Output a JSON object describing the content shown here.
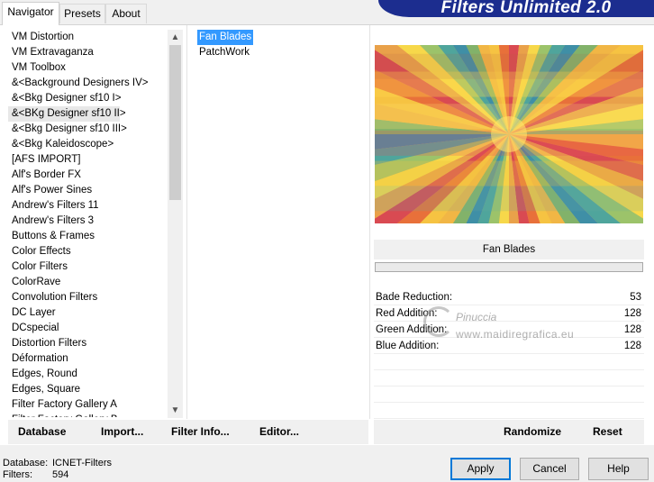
{
  "tabs": [
    {
      "label": "Navigator",
      "active": true
    },
    {
      "label": "Presets",
      "active": false
    },
    {
      "label": "About",
      "active": false
    }
  ],
  "app_title": "Filters Unlimited 2.0",
  "categories": [
    "VM Distortion",
    "VM Extravaganza",
    "VM Toolbox",
    "&<Background Designers IV>",
    "&<Bkg Designer sf10 I>",
    "&<BKg Designer sf10 II>",
    "&<Bkg Designer sf10 III>",
    "&<Bkg Kaleidoscope>",
    "[AFS IMPORT]",
    "Alf's Border FX",
    "Alf's Power Sines",
    "Andrew's Filters 11",
    "Andrew's Filters 3",
    "Buttons & Frames",
    "Color Effects",
    "Color Filters",
    "ColorRave",
    "Convolution Filters",
    "DC Layer",
    "DCspecial",
    "Distortion Filters",
    "Déformation",
    "Edges, Round",
    "Edges, Square",
    "Filter Factory Gallery A",
    "Filter Factory Gallery B"
  ],
  "selected_category": "&<BKg Designer sf10 II>",
  "filters": [
    "Fan Blades",
    "PatchWork"
  ],
  "selected_filter": "Fan Blades",
  "preview_filter_name": "Fan Blades",
  "progress": 0.0,
  "params": [
    {
      "label": "Bade Reduction:",
      "value": "53"
    },
    {
      "label": "Red Addition:",
      "value": "128"
    },
    {
      "label": "Green Addition:",
      "value": "128"
    },
    {
      "label": "Blue Addition:",
      "value": "128"
    }
  ],
  "watermark": {
    "name": "Pinuccia",
    "url": "www.maidiregrafica.eu"
  },
  "bottom_actions": {
    "database": "Database",
    "import": "Import...",
    "filter_info": "Filter Info...",
    "editor": "Editor...",
    "randomize": "Randomize",
    "reset": "Reset"
  },
  "status": {
    "database_label": "Database:",
    "database_value": "ICNET-Filters",
    "filters_label": "Filters:",
    "filters_value": "594"
  },
  "buttons": {
    "apply": "Apply",
    "cancel": "Cancel",
    "help": "Help"
  },
  "colors": {
    "banner": "#1c2d8f",
    "selection": "#3399ff",
    "fan_palette": [
      "#f6c342",
      "#e8703a",
      "#d94a52",
      "#e9a14a",
      "#f7d84a",
      "#9cc36a",
      "#4fa59c",
      "#3f8fa6",
      "#82b26a",
      "#f1b645"
    ]
  }
}
